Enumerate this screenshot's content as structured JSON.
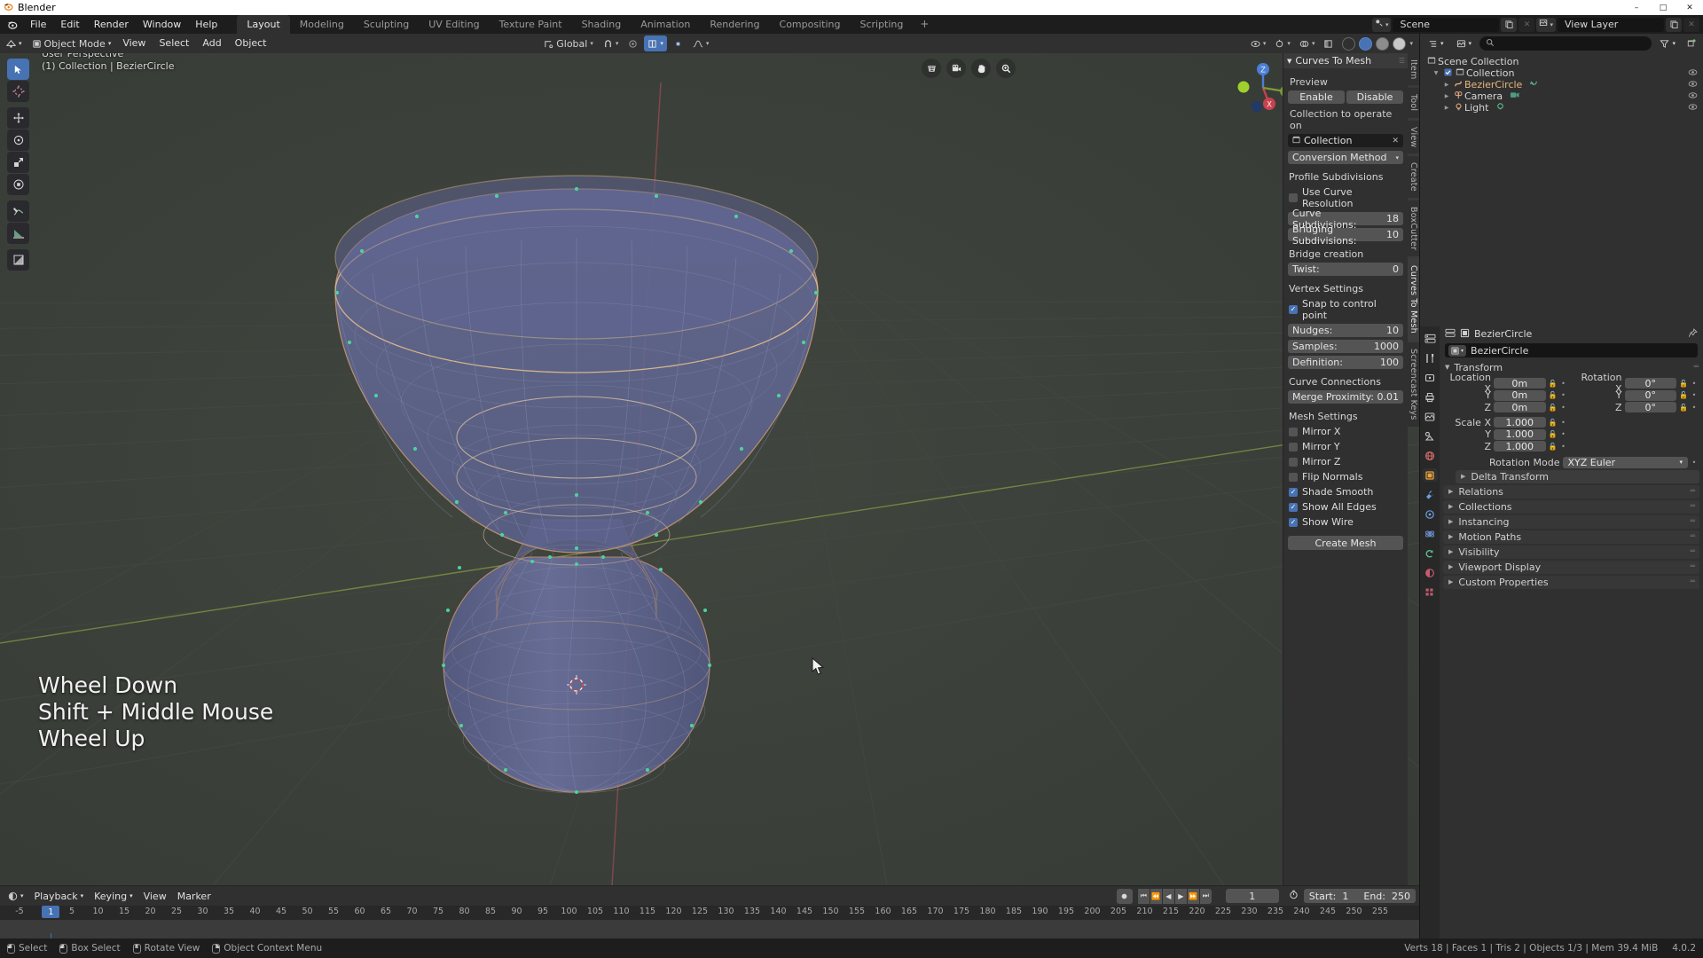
{
  "window": {
    "title": "Blender",
    "icon": "blender-logo-icon",
    "minimize": "–",
    "maximize": "□",
    "close": "✕"
  },
  "topbar": {
    "menus": [
      "File",
      "Edit",
      "Render",
      "Window",
      "Help"
    ],
    "workspaces": [
      {
        "label": "Layout",
        "active": true
      },
      {
        "label": "Modeling",
        "active": false
      },
      {
        "label": "Sculpting",
        "active": false
      },
      {
        "label": "UV Editing",
        "active": false
      },
      {
        "label": "Texture Paint",
        "active": false
      },
      {
        "label": "Shading",
        "active": false
      },
      {
        "label": "Animation",
        "active": false
      },
      {
        "label": "Rendering",
        "active": false
      },
      {
        "label": "Compositing",
        "active": false
      },
      {
        "label": "Scripting",
        "active": false
      }
    ],
    "add_workspace": "+",
    "scene_name": "Scene",
    "view_layer_name": "View Layer"
  },
  "viewport": {
    "header": {
      "mode": "Object Mode",
      "menus": [
        "View",
        "Select",
        "Add",
        "Object"
      ],
      "transform_orientation": "Global",
      "snap_label": "snap-magnet-icon",
      "proportional_label": "proportional-edit-icon"
    },
    "overlay": {
      "perspective": "User Perspective",
      "collection_object": "(1) Collection | BezierCircle"
    },
    "screencast_keys": [
      "Wheel Down",
      "Shift + Middle Mouse",
      "Wheel Up"
    ],
    "tools": [
      {
        "name": "tweak-select-tool",
        "glyph": "➤",
        "active": true
      },
      {
        "name": "cursor-tool",
        "glyph": "⊕",
        "active": false
      },
      {
        "name": "move-tool",
        "glyph": "✥",
        "active": false
      },
      {
        "name": "rotate-tool",
        "glyph": "↻",
        "active": false
      },
      {
        "name": "scale-tool",
        "glyph": "⤡",
        "active": false
      },
      {
        "name": "transform-tool",
        "glyph": "◈",
        "active": false
      },
      {
        "name": "annotate-tool",
        "glyph": "✎",
        "active": false
      },
      {
        "name": "measure-tool",
        "glyph": "📐",
        "active": false
      },
      {
        "name": "add-cube-tool",
        "glyph": "◪",
        "active": false
      }
    ],
    "nav_buttons": [
      {
        "name": "toggle-camera-perspective-icon",
        "glyph": "▦"
      },
      {
        "name": "camera-view-icon",
        "glyph": "🎥"
      },
      {
        "name": "move-view-hand-icon",
        "glyph": "✋"
      },
      {
        "name": "zoom-view-icon",
        "glyph": "🔍"
      }
    ],
    "gizmo_axes": [
      "X",
      "Y",
      "Z"
    ]
  },
  "sidebar_tabs": [
    {
      "label": "Item",
      "active": false
    },
    {
      "label": "Tool",
      "active": false
    },
    {
      "label": "View",
      "active": false
    },
    {
      "label": "Create",
      "active": false
    },
    {
      "label": "BoxCutter",
      "active": false
    },
    {
      "label": "Curves To Mesh",
      "active": true
    },
    {
      "label": "Screencast Keys",
      "active": false
    }
  ],
  "npanel": {
    "title": "Curves To Mesh",
    "preview_label": "Preview",
    "enable_label": "Enable",
    "disable_label": "Disable",
    "collection_label": "Collection to operate on",
    "collection_value": "Collection",
    "collection_clear": "✕",
    "conversion_method": "Conversion Method",
    "profile_subdivisions_label": "Profile Subdivisions",
    "use_curve_resolution": {
      "label": "Use Curve Resolution",
      "checked": false
    },
    "curve_subdivisions": {
      "label": "Curve Subdivisions:",
      "value": "18"
    },
    "bridging_subdivisions": {
      "label": "Bridging Subdivisions:",
      "value": "10"
    },
    "bridge_creation_label": "Bridge creation",
    "twist": {
      "label": "Twist:",
      "value": "0"
    },
    "vertex_settings_label": "Vertex Settings",
    "snap_to_control_point": {
      "label": "Snap to control point",
      "checked": true
    },
    "nudges": {
      "label": "Nudges:",
      "value": "10"
    },
    "samples": {
      "label": "Samples:",
      "value": "1000"
    },
    "definition": {
      "label": "Definition:",
      "value": "100"
    },
    "curve_connections_label": "Curve Connections",
    "merge_proximity": {
      "label": "Merge Proximity:",
      "value": "0.01"
    },
    "mesh_settings_label": "Mesh Settings",
    "mirror_x": {
      "label": "Mirror X",
      "checked": false
    },
    "mirror_y": {
      "label": "Mirror Y",
      "checked": false
    },
    "mirror_z": {
      "label": "Mirror Z",
      "checked": false
    },
    "flip_normals": {
      "label": "Flip Normals",
      "checked": false
    },
    "shade_smooth": {
      "label": "Shade Smooth",
      "checked": true
    },
    "show_all_edges": {
      "label": "Show All Edges",
      "checked": true
    },
    "show_wire": {
      "label": "Show Wire",
      "checked": true
    },
    "create_mesh": "Create Mesh"
  },
  "outliner": {
    "search_placeholder": "",
    "display_mode_icon": "view-layer-icon",
    "filter_icon": "filter-icon",
    "rows": [
      {
        "label": "Scene Collection",
        "icon": "collection-icon",
        "indent": 0,
        "tri": "",
        "selected": false,
        "eye": false
      },
      {
        "label": "Collection",
        "icon": "collection-icon",
        "indent": 1,
        "tri": "▼",
        "selected": false,
        "eye": true,
        "checkbox": true
      },
      {
        "label": "BezierCircle",
        "icon": "curve-icon",
        "indent": 2,
        "tri": "▶",
        "selected": true,
        "eye": true,
        "badge": "modifier-icon"
      },
      {
        "label": "Camera",
        "icon": "camera-icon",
        "indent": 2,
        "tri": "▶",
        "selected": false,
        "eye": true,
        "badge": "camera-data-icon"
      },
      {
        "label": "Light",
        "icon": "light-icon",
        "indent": 2,
        "tri": "▶",
        "selected": false,
        "eye": true,
        "badge": "light-data-icon"
      }
    ]
  },
  "properties": {
    "tabs": [
      {
        "name": "tool-tab",
        "glyph": "🛠",
        "color": "#cfcfcf",
        "active": false
      },
      {
        "name": "render-tab",
        "glyph": "▣",
        "color": "#cfcfcf",
        "active": false
      },
      {
        "name": "output-tab",
        "glyph": "🖨",
        "color": "#cfcfcf",
        "active": false
      },
      {
        "name": "view-layer-tab",
        "glyph": "🖼",
        "color": "#cfcfcf",
        "active": false
      },
      {
        "name": "scene-tab",
        "glyph": "🔆",
        "color": "#cfcfcf",
        "active": false
      },
      {
        "name": "world-tab",
        "glyph": "◍",
        "color": "#d06060",
        "active": false
      },
      {
        "name": "object-tab",
        "glyph": "▣",
        "color": "#e8a33d",
        "active": true
      },
      {
        "name": "modifier-tab",
        "glyph": "🔧",
        "color": "#6d9fe0",
        "active": false
      },
      {
        "name": "particles-tab",
        "glyph": "◉",
        "color": "#6d9fe0",
        "active": false
      },
      {
        "name": "physics-tab",
        "glyph": "◎",
        "color": "#6d8fd0",
        "active": false
      },
      {
        "name": "constraints-tab",
        "glyph": "↺",
        "color": "#5fba8f",
        "active": false
      },
      {
        "name": "object-data-tab",
        "glyph": "◐",
        "color": "#c65a6e",
        "active": false
      },
      {
        "name": "texture-tab",
        "glyph": "▩",
        "color": "#c05a6e",
        "active": false
      }
    ],
    "breadcrumb_object": "BezierCircle",
    "id_name": "BezierCircle",
    "pin_icon": "pin-icon",
    "transform_title": "Transform",
    "location": {
      "label": "Location X",
      "labels": [
        "Location X",
        "Y",
        "Z"
      ],
      "values": [
        "0m",
        "0m",
        "0m"
      ]
    },
    "rotation": {
      "labels": [
        "Rotation X",
        "Y",
        "Z"
      ],
      "values": [
        "0°",
        "0°",
        "0°"
      ]
    },
    "scale": {
      "labels": [
        "Scale X",
        "Y",
        "Z"
      ],
      "values": [
        "1.000",
        "1.000",
        "1.000"
      ]
    },
    "rotation_mode": {
      "label": "Rotation Mode",
      "value": "XYZ Euler"
    },
    "delta_transform": "Delta Transform",
    "collapsed_panels": [
      "Relations",
      "Collections",
      "Instancing",
      "Motion Paths",
      "Visibility",
      "Viewport Display",
      "Custom Properties"
    ]
  },
  "timeline": {
    "menus": [
      "Playback",
      "Keying",
      "View",
      "Marker"
    ],
    "playback_icon": "playback-icon",
    "transport": [
      "⏮",
      "⏪",
      "◀",
      "▶",
      "⏩",
      "⏭"
    ],
    "record_icon": "auto-keying-icon",
    "current_frame": "1",
    "timer_icon": "use-preview-range-icon",
    "start_label": "Start:",
    "start_value": "1",
    "end_label": "End:",
    "end_value": "250",
    "ticks": [
      "-5",
      "1",
      "5",
      "10",
      "15",
      "20",
      "25",
      "30",
      "35",
      "40",
      "45",
      "50",
      "55",
      "60",
      "65",
      "70",
      "75",
      "80",
      "85",
      "90",
      "95",
      "100",
      "105",
      "110",
      "115",
      "120",
      "125",
      "130",
      "135",
      "140",
      "145",
      "150",
      "155",
      "160",
      "165",
      "170",
      "175",
      "180",
      "185",
      "190",
      "195",
      "200",
      "205",
      "210",
      "215",
      "220",
      "225",
      "230",
      "235",
      "240",
      "245",
      "250",
      "255"
    ],
    "playhead_frame": "1"
  },
  "statusbar": {
    "items": [
      {
        "mouse": "left",
        "label": "Select"
      },
      {
        "mouse": "left",
        "label": "Box Select"
      },
      {
        "mouse": "right",
        "label": "Rotate View"
      },
      {
        "mouse": "right",
        "label": "Object Context Menu"
      }
    ],
    "version_left": "Collection | BezierCircle",
    "stats": "Verts 18 | Faces 1 | Tris 2 | Objects 1/3 | Mem 39.4 MiB",
    "version": "4.0.2"
  },
  "colors": {
    "accent_blue": "#4772b3",
    "orange_select": "#e8b77b",
    "header_bg": "#303030",
    "viewport_bg": "#393d39",
    "object_surface": "#6b7099",
    "axis_x": "#9c4a4f",
    "axis_y": "#7c8c3f"
  }
}
